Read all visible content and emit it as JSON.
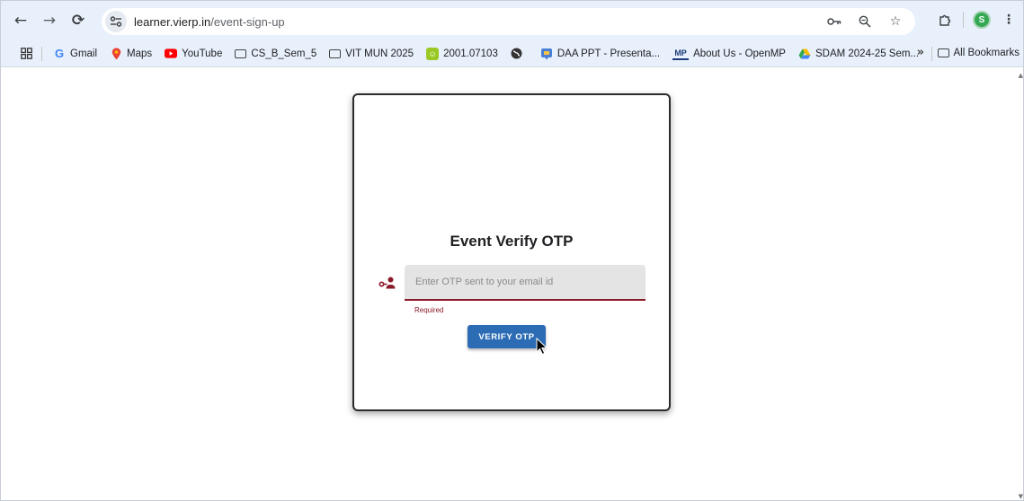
{
  "browser": {
    "url_domain": "learner.vierp.in",
    "url_path": "/event-sign-up",
    "profile_initial": "S"
  },
  "bookmarks": {
    "items": [
      {
        "label": "Gmail",
        "icon": "gmail-icon"
      },
      {
        "label": "Maps",
        "icon": "maps-icon"
      },
      {
        "label": "YouTube",
        "icon": "youtube-icon"
      },
      {
        "label": "CS_B_Sem_5",
        "icon": "folder-icon"
      },
      {
        "label": "VIT MUN 2025",
        "icon": "folder-icon"
      },
      {
        "label": "2001.07103",
        "icon": "arxiv-icon"
      },
      {
        "label": "",
        "icon": "globe-icon"
      },
      {
        "label": "DAA PPT - Presenta...",
        "icon": "slides-icon"
      },
      {
        "label": "About Us - OpenMP",
        "icon": "openmp-icon"
      },
      {
        "label": "SDAM 2024-25 Sem...",
        "icon": "drive-icon"
      }
    ],
    "more": "»",
    "all_bookmarks": "All Bookmarks"
  },
  "form": {
    "title": "Event Verify OTP",
    "otp_placeholder": "Enter OTP sent to your email id",
    "otp_value": "",
    "error_text": "Required",
    "submit_label": "VERIFY OTP"
  },
  "colors": {
    "accent": "#2c6cb5",
    "error": "#8b1a2b",
    "browser_chrome": "#e8f0fb"
  }
}
